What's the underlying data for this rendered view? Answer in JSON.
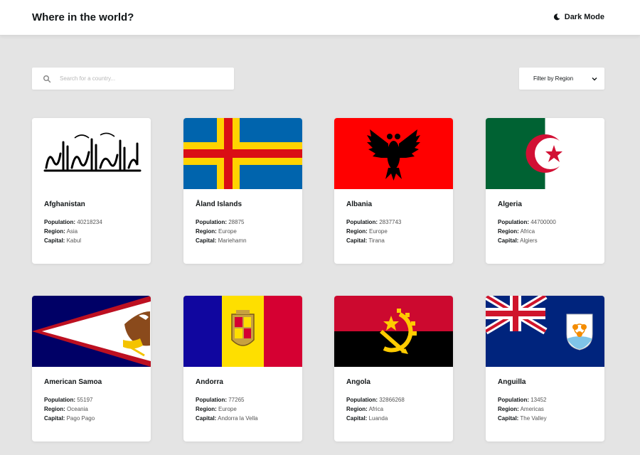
{
  "header": {
    "title": "Where in the world?",
    "mode_label": "Dark Mode",
    "mode_icon": "moon-icon"
  },
  "search": {
    "placeholder": "Search for a country...",
    "value": "",
    "icon": "search-icon"
  },
  "filter": {
    "label": "Filter by Region",
    "icon": "chevron-down-icon"
  },
  "field_labels": {
    "population": "Population:",
    "region": "Region:",
    "capital": "Capital:"
  },
  "countries": [
    {
      "name": "Afghanistan",
      "population": "40218234",
      "region": "Asia",
      "capital": "Kabul"
    },
    {
      "name": "Åland Islands",
      "population": "28875",
      "region": "Europe",
      "capital": "Mariehamn"
    },
    {
      "name": "Albania",
      "population": "2837743",
      "region": "Europe",
      "capital": "Tirana"
    },
    {
      "name": "Algeria",
      "population": "44700000",
      "region": "Africa",
      "capital": "Algiers"
    },
    {
      "name": "American Samoa",
      "population": "55197",
      "region": "Oceania",
      "capital": "Pago Pago"
    },
    {
      "name": "Andorra",
      "population": "77265",
      "region": "Europe",
      "capital": "Andorra la Vella"
    },
    {
      "name": "Angola",
      "population": "32866268",
      "region": "Africa",
      "capital": "Luanda"
    },
    {
      "name": "Anguilla",
      "population": "13452",
      "region": "Americas",
      "capital": "The Valley"
    }
  ],
  "colors": {
    "background": "#e4e4e4",
    "element": "#ffffff",
    "text": "#111517"
  }
}
